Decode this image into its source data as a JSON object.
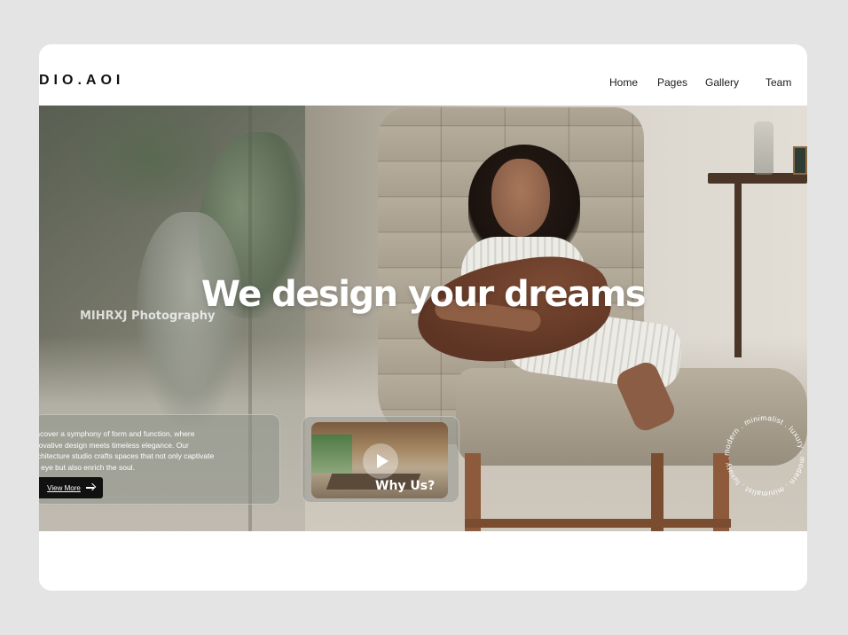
{
  "brand": {
    "name": "DIO.AOI"
  },
  "nav": {
    "items": [
      "Home",
      "Pages",
      "Gallery",
      "Team"
    ]
  },
  "hero": {
    "headline": "We design your dreams",
    "credit": "MIHRXJ Photography",
    "info": {
      "lines": [
        "iscover a symphony of form and function, where",
        "novative design meets timeless elegance. Our",
        "rchitecture studio crafts spaces that not only captivate",
        "e eye but also enrich the soul."
      ],
      "button_label": "View More"
    },
    "video": {
      "label": "Why Us?"
    },
    "badge": {
      "text": "modern . minimalist . luxury . modern . minimalist . luxury . "
    }
  },
  "icons": {
    "arrow": "arrow-right-icon",
    "play": "play-icon"
  },
  "colors": {
    "button_bg": "#111111",
    "headline": "#ffffff",
    "page_bg": "#e4e4e4"
  }
}
